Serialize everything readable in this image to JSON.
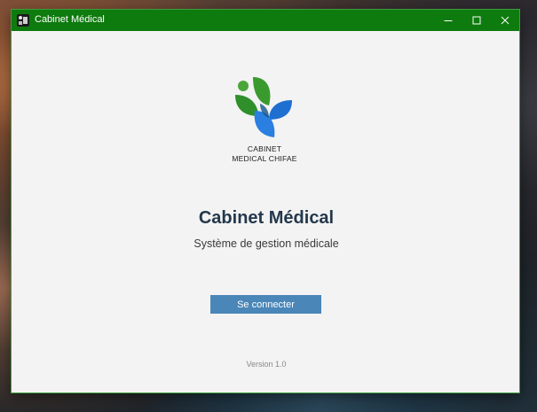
{
  "window": {
    "title": "Cabinet Médical",
    "accent_color": "#0e7b0e",
    "icon": "medical-app-icon",
    "controls": {
      "minimize": "minimize-icon",
      "maximize": "maximize-icon",
      "close": "close-icon"
    }
  },
  "logo": {
    "line1": "CABINET",
    "line2": "MEDICAL CHIFAE",
    "colors": {
      "green": "#3a9a2e",
      "blue": "#1f6fd1"
    }
  },
  "main": {
    "title": "Cabinet Médical",
    "subtitle": "Système de gestion médicale",
    "login_label": "Se connecter",
    "version": "Version 1.0"
  },
  "colors": {
    "button": "#4a86b8",
    "title_text": "#24384c",
    "background": "#f3f3f3"
  }
}
